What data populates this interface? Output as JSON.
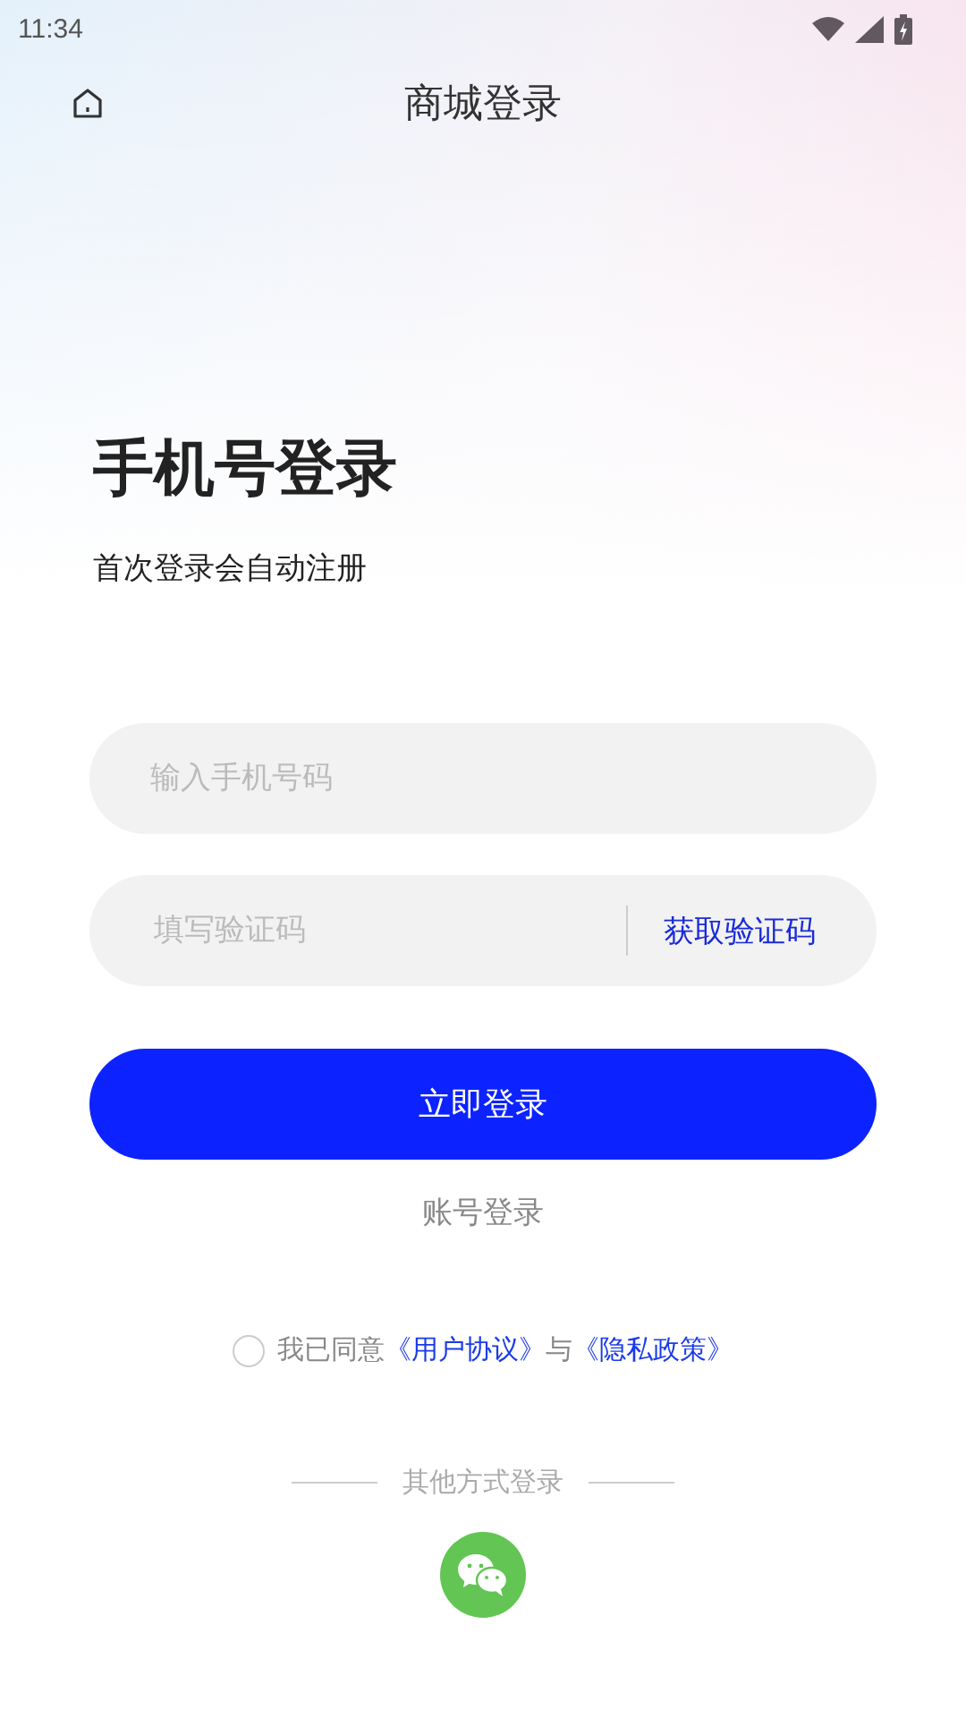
{
  "status_bar": {
    "time": "11:34"
  },
  "nav": {
    "title": "商城登录"
  },
  "heading": "手机号登录",
  "subtitle": "首次登录会自动注册",
  "phone_field": {
    "placeholder": "输入手机号码"
  },
  "code_field": {
    "placeholder": "填写验证码",
    "action": "获取验证码"
  },
  "login_button": "立即登录",
  "account_login": "账号登录",
  "agreement": {
    "checked": false,
    "parts": [
      {
        "kind": "text",
        "text": "我已同意"
      },
      {
        "kind": "link",
        "text": "《用户协议》"
      },
      {
        "kind": "text",
        "text": "与"
      },
      {
        "kind": "link",
        "text": "《隐私政策》"
      }
    ]
  },
  "other_login": {
    "label": "其他方式登录"
  }
}
